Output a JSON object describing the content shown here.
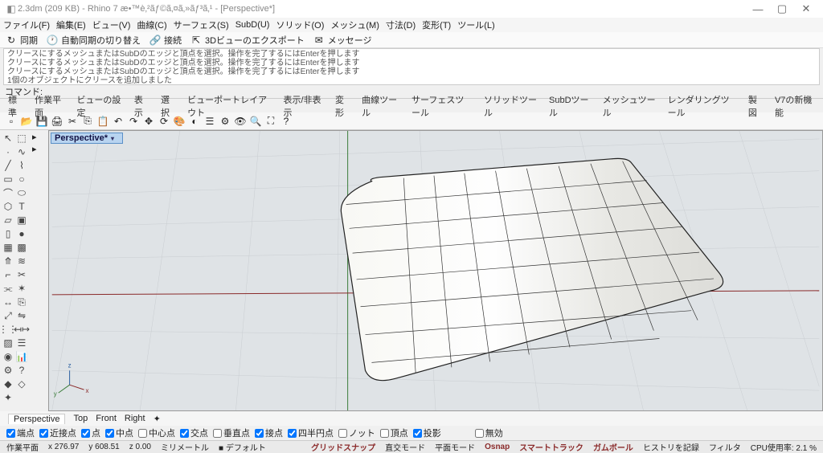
{
  "title": "2.3dm (209 KB) - Rhino 7 æ•™è‚²ãƒ©ã‚¤ã‚»ãƒ³ã‚¹ - [Perspective*]",
  "winbtns": {
    "min": "—",
    "max": "▢",
    "close": "✕"
  },
  "menu": [
    "ファイル(F)",
    "編集(E)",
    "ビュー(V)",
    "曲線(C)",
    "サーフェス(S)",
    "SubD(U)",
    "ソリッド(O)",
    "メッシュ(M)",
    "寸法(D)",
    "変形(T)",
    "ツール(L)"
  ],
  "sync": {
    "sync": "同期",
    "auto": "自動同期の切り替え",
    "connect": "接続",
    "export": "3Dビューのエクスポート",
    "msg": "メッセージ"
  },
  "history": {
    "l1": "クリースにするメッシュまたはSubDのエッジと頂点を選択。操作を完了するにはEnterを押します",
    "l2": "クリースにするメッシュまたはSubDのエッジと頂点を選択。操作を完了するにはEnterを押します",
    "l3": "クリースにするメッシュまたはSubDのエッジと頂点を選択。操作を完了するにはEnterを押します",
    "l4": "1個のオブジェクトにクリースを追加しました"
  },
  "cmd": {
    "label": "コマンド:",
    "value": ""
  },
  "tabs1": [
    "標準",
    "作業平面",
    "ビューの設定",
    "表示",
    "選択",
    "ビューポートレイアウト",
    "表示/非表示",
    "変形",
    "曲線ツール",
    "サーフェスツール",
    "ソリッドツール",
    "SubDツール",
    "メッシュツール",
    "レンダリングツール",
    "製図",
    "V7の新機能"
  ],
  "vp": {
    "label": "Perspective*"
  },
  "viewtabs": [
    "Perspective",
    "Top",
    "Front",
    "Right",
    "✦"
  ],
  "osnap": {
    "opts": [
      {
        "label": "端点",
        "checked": true
      },
      {
        "label": "近接点",
        "checked": true
      },
      {
        "label": "点",
        "checked": true
      },
      {
        "label": "中点",
        "checked": true
      },
      {
        "label": "中心点",
        "checked": false
      },
      {
        "label": "交点",
        "checked": true
      },
      {
        "label": "垂直点",
        "checked": false
      },
      {
        "label": "接点",
        "checked": true
      },
      {
        "label": "四半円点",
        "checked": true
      },
      {
        "label": "ノット",
        "checked": false
      },
      {
        "label": "頂点",
        "checked": false
      },
      {
        "label": "投影",
        "checked": true
      }
    ],
    "disable": "無効"
  },
  "status": {
    "cplane": "作業平面",
    "x": "x 276.97",
    "y": "y 608.51",
    "z": "z 0.00",
    "units": "ミリメートル",
    "layer": "■ デフォルト",
    "grid": "グリッドスナップ",
    "ortho": "直交モード",
    "planar": "平面モード",
    "osnap": "Osnap",
    "smart": "スマートトラック",
    "gumball": "ガムボール",
    "hist": "ヒストリを記録",
    "filter": "フィルタ",
    "cpu": "CPU使用率: 2.1 %"
  }
}
